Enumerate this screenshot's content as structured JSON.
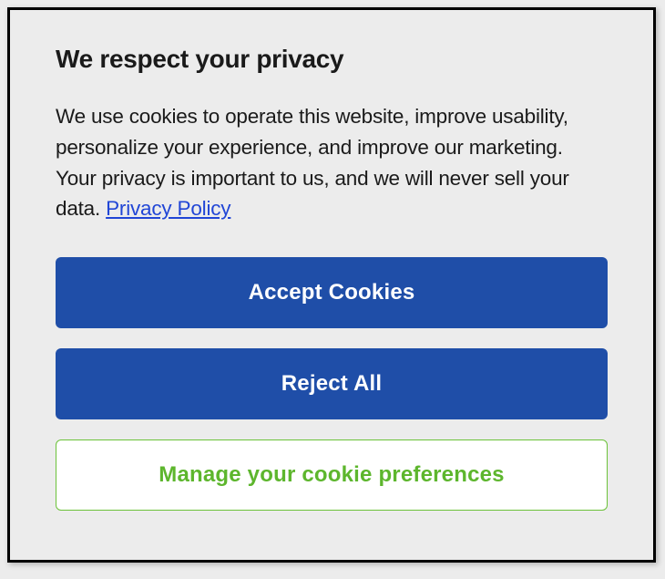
{
  "modal": {
    "title": "We respect your privacy",
    "body_text": "We use cookies to operate this website, improve usability, personalize your experience, and improve our marketing. Your privacy is important to us, and we will never sell your data. ",
    "privacy_link_text": "Privacy Policy",
    "buttons": {
      "accept": "Accept Cookies",
      "reject": "Reject All",
      "manage": "Manage your cookie preferences"
    }
  }
}
